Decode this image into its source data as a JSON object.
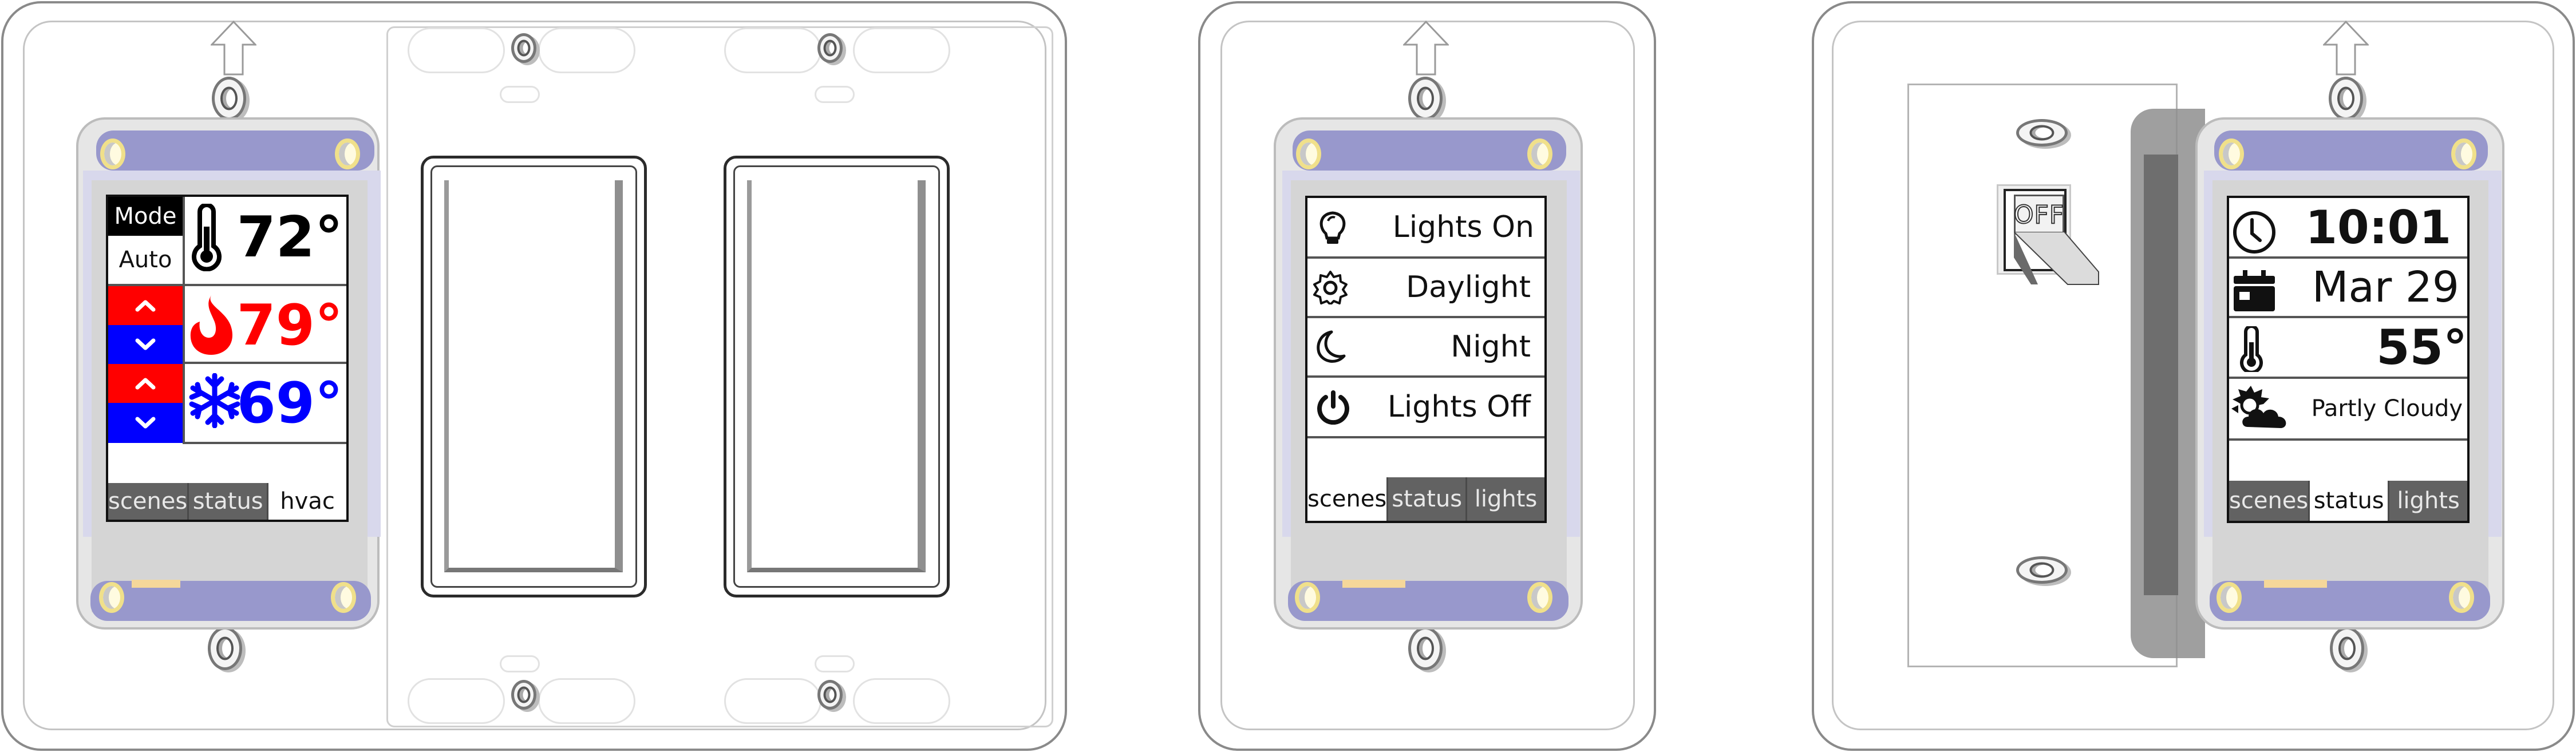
{
  "devices": {
    "hvac": {
      "mode_label": "Mode",
      "mode_value": "Auto",
      "current_temp": "72°",
      "heat_setpoint": "79°",
      "cool_setpoint": "69°",
      "up_glyph": "^",
      "down_glyph": "v",
      "icons": {
        "current": "thermometer-icon",
        "heat": "flame-icon",
        "cool": "snowflake-icon"
      },
      "colors": {
        "heat": "#ff0000",
        "cool": "#0000ff",
        "text": "#000000"
      },
      "tabs": [
        {
          "label": "scenes",
          "active": false
        },
        {
          "label": "status",
          "active": false
        },
        {
          "label": "hvac",
          "active": true
        }
      ]
    },
    "scenes": {
      "items": [
        {
          "label": "Lights On",
          "icon": "lightbulb-icon"
        },
        {
          "label": "Daylight",
          "icon": "sun-icon"
        },
        {
          "label": "Night",
          "icon": "moon-icon"
        },
        {
          "label": "Lights Off",
          "icon": "power-icon"
        }
      ],
      "tabs": [
        {
          "label": "scenes",
          "active": true
        },
        {
          "label": "status",
          "active": false
        },
        {
          "label": "lights",
          "active": false
        }
      ]
    },
    "status": {
      "time": "10:01",
      "date": "Mar 29",
      "temperature": "55°",
      "weather": "Partly Cloudy",
      "icons": {
        "time": "clock-icon",
        "date": "calendar-icon",
        "temperature": "thermometer-icon",
        "weather": "partly-cloudy-icon"
      },
      "tabs": [
        {
          "label": "scenes",
          "active": false
        },
        {
          "label": "status",
          "active": true
        },
        {
          "label": "lights",
          "active": false
        }
      ]
    }
  },
  "toggle_switch": {
    "label": "OFF"
  },
  "theme": {
    "pcb": "#9898cc",
    "grommet": "#f0e08a",
    "tab_inactive": "#626262",
    "tab_active": "#ffffff"
  }
}
